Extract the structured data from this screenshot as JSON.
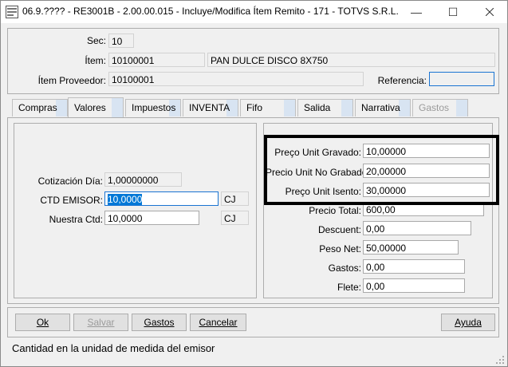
{
  "window": {
    "title": "06.9.???? - RE3001B - 2.00.00.015 - Incluye/Modifica Ítem Remito - 171 - TOTVS S.R.L.",
    "minimize_glyph": "—",
    "maximize_glyph": "☐"
  },
  "header": {
    "sec_label": "Sec:",
    "sec_value": "10",
    "item_label": "Ítem:",
    "item_code": "10100001",
    "item_desc": "PAN DULCE DISCO 8X750",
    "proveedor_label": "Ítem Proveedor:",
    "proveedor_value": "10100001",
    "referencia_label": "Referencia:",
    "referencia_value": ""
  },
  "tabs": [
    {
      "label": "Compras"
    },
    {
      "label": "Valores"
    },
    {
      "label": "Impuestos"
    },
    {
      "label": "INVENTA"
    },
    {
      "label": "Fifo"
    },
    {
      "label": "Salida"
    },
    {
      "label": "Narrativa"
    },
    {
      "label": "Gastos"
    }
  ],
  "left": {
    "cotizacion_label": "Cotización Día:",
    "cotizacion_value": "1,00000000",
    "ctd_emisor_label": "CTD EMISOR:",
    "ctd_emisor_value": "10,0000",
    "ctd_emisor_unit": "CJ",
    "nuestra_label": "Nuestra Ctd:",
    "nuestra_value": "10,0000",
    "nuestra_unit": "CJ"
  },
  "right": {
    "preco_gravado_label": "Preço Unit Gravado:",
    "preco_gravado_value": "10,00000",
    "precio_no_grabado_label": "Precio Unit No Grabado:",
    "precio_no_grabado_value": "20,00000",
    "preco_isento_label": "Preço Unit Isento:",
    "preco_isento_value": "30,00000",
    "precio_total_label": "Precio Total:",
    "precio_total_value": "600,00",
    "descuent_label": "Descuent:",
    "descuent_value": "0,00",
    "peso_label": "Peso Net:",
    "peso_value": "50,00000",
    "gastos_label": "Gastos:",
    "gastos_value": "0,00",
    "flete_label": "Flete:",
    "flete_value": "0,00"
  },
  "buttons": {
    "ok": "Ok",
    "salvar": "Salvar",
    "gastos": "Gastos",
    "cancelar": "Cancelar",
    "ayuda": "Ayuda"
  },
  "status": {
    "text": "Cantidad en la unidad de medida del emisor"
  },
  "colors": {
    "accent": "#0078d7",
    "tab_shade": "#d8e4f2",
    "highlight_border": "#000000"
  }
}
